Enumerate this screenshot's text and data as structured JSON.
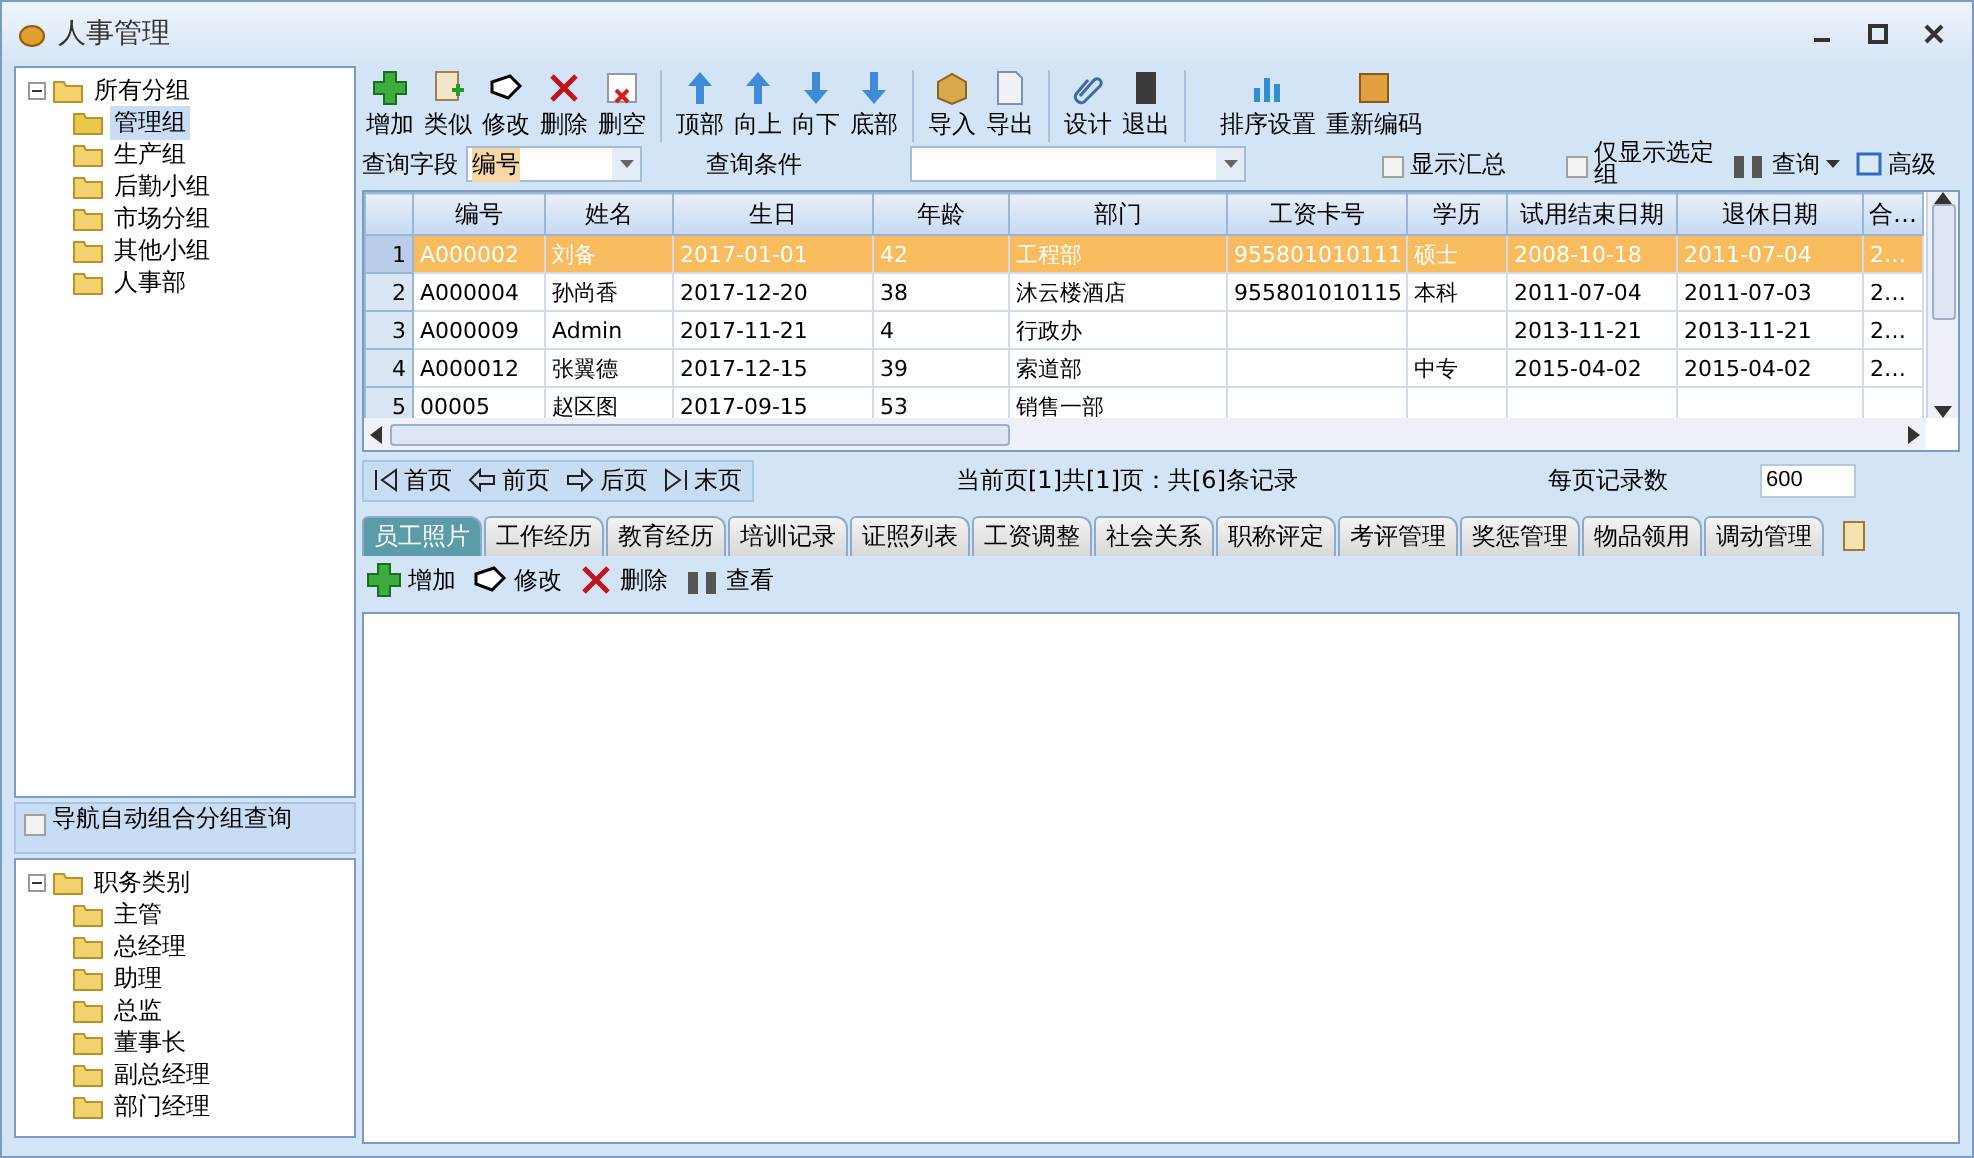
{
  "window": {
    "title": "人事管理"
  },
  "nav_tree": {
    "label": "所有分组",
    "expanded": true,
    "children": [
      {
        "label": "管理组",
        "selected": true
      },
      {
        "label": "生产组",
        "selected": false
      },
      {
        "label": "后勤小组",
        "selected": false
      },
      {
        "label": "市场分组",
        "selected": false
      },
      {
        "label": "其他小组",
        "selected": false
      },
      {
        "label": "人事部",
        "selected": false
      }
    ]
  },
  "nav_option": {
    "label": "导航自动组合分组查询",
    "checked": false
  },
  "category_tree": {
    "label": "职务类别",
    "expanded": true,
    "children": [
      {
        "label": "主管",
        "selected": false
      },
      {
        "label": "总经理",
        "selected": false
      },
      {
        "label": "助理",
        "selected": false
      },
      {
        "label": "总监",
        "selected": false
      },
      {
        "label": "董事长",
        "selected": false
      },
      {
        "label": "副总经理",
        "selected": false
      },
      {
        "label": "部门经理",
        "selected": false
      }
    ]
  },
  "toolbar": [
    [
      {
        "label": "增加",
        "kind": "add"
      },
      {
        "label": "类似",
        "kind": "copy"
      },
      {
        "label": "修改",
        "kind": "edit"
      },
      {
        "label": "删除",
        "kind": "delete"
      },
      {
        "label": "删空",
        "kind": "clear"
      }
    ],
    [
      {
        "label": "顶部",
        "kind": "top"
      },
      {
        "label": "向上",
        "kind": "up"
      },
      {
        "label": "向下",
        "kind": "down"
      },
      {
        "label": "底部",
        "kind": "bottom"
      }
    ],
    [
      {
        "label": "导入",
        "kind": "import"
      },
      {
        "label": "导出",
        "kind": "export"
      }
    ],
    [
      {
        "label": "设计",
        "kind": "design"
      },
      {
        "label": "退出",
        "kind": "exit"
      }
    ],
    [
      {
        "label": "排序设置",
        "kind": "chart"
      },
      {
        "label": "重新编码",
        "kind": "recode"
      }
    ]
  ],
  "query": {
    "field_label": "查询字段",
    "field_value": "编号",
    "condition_label": "查询条件",
    "show_summary": {
      "label": "显示汇总",
      "checked": false
    },
    "only_selected": {
      "label": "仅显示选定组",
      "checked": false
    },
    "query_button": "查询",
    "advanced_button": "高级"
  },
  "table": {
    "columns": [
      "编号",
      "姓名",
      "生日",
      "年龄",
      "部门",
      "工资卡号",
      "学历",
      "试用结束日期",
      "退休日期",
      "合…"
    ],
    "rows": [
      {
        "number": "1",
        "selected": true,
        "cells": [
          "A000002",
          "刘备",
          "2017-01-01",
          "42",
          "工程部",
          "955801010111",
          "硕士",
          "2008-10-18",
          "2011-07-04",
          "2…"
        ]
      },
      {
        "number": "2",
        "selected": false,
        "cells": [
          "A000004",
          "孙尚香",
          "2017-12-20",
          "38",
          "沐云楼酒店",
          "955801010115",
          "本科",
          "2011-07-04",
          "2011-07-03",
          "2…"
        ]
      },
      {
        "number": "3",
        "selected": false,
        "cells": [
          "A000009",
          "Admin",
          "2017-11-21",
          "4",
          "行政办",
          "",
          "",
          "2013-11-21",
          "2013-11-21",
          "2…"
        ]
      },
      {
        "number": "4",
        "selected": false,
        "cells": [
          "A000012",
          "张翼德",
          "2017-12-15",
          "39",
          "索道部",
          "",
          "中专",
          "2015-04-02",
          "2015-04-02",
          "2…"
        ]
      },
      {
        "number": "5",
        "selected": false,
        "cells": [
          "00005",
          "赵区图",
          "2017-09-15",
          "53",
          "销售一部",
          "",
          "",
          "",
          "",
          ""
        ]
      }
    ]
  },
  "pager": {
    "buttons": [
      {
        "label": "首页",
        "kind": "first"
      },
      {
        "label": "前页",
        "kind": "prev"
      },
      {
        "label": "后页",
        "kind": "next"
      },
      {
        "label": "末页",
        "kind": "last"
      }
    ],
    "status": "当前页[1]共[1]页：共[6]条记录",
    "per_page_label": "每页记录数",
    "per_page_value": "600"
  },
  "tabs": [
    {
      "label": "员工照片",
      "selected": true
    },
    {
      "label": "工作经历",
      "selected": false
    },
    {
      "label": "教育经历",
      "selected": false
    },
    {
      "label": "培训记录",
      "selected": false
    },
    {
      "label": "证照列表",
      "selected": false
    },
    {
      "label": "工资调整",
      "selected": false
    },
    {
      "label": "社会关系",
      "selected": false
    },
    {
      "label": "职称评定",
      "selected": false
    },
    {
      "label": "考评管理",
      "selected": false
    },
    {
      "label": "奖惩管理",
      "selected": false
    },
    {
      "label": "物品领用",
      "selected": false
    },
    {
      "label": "调动管理",
      "selected": false
    }
  ],
  "sub_toolbar": [
    {
      "label": "增加",
      "kind": "add"
    },
    {
      "label": "修改",
      "kind": "edit"
    },
    {
      "label": "删除",
      "kind": "delete"
    },
    {
      "label": "查看",
      "kind": "view"
    }
  ]
}
